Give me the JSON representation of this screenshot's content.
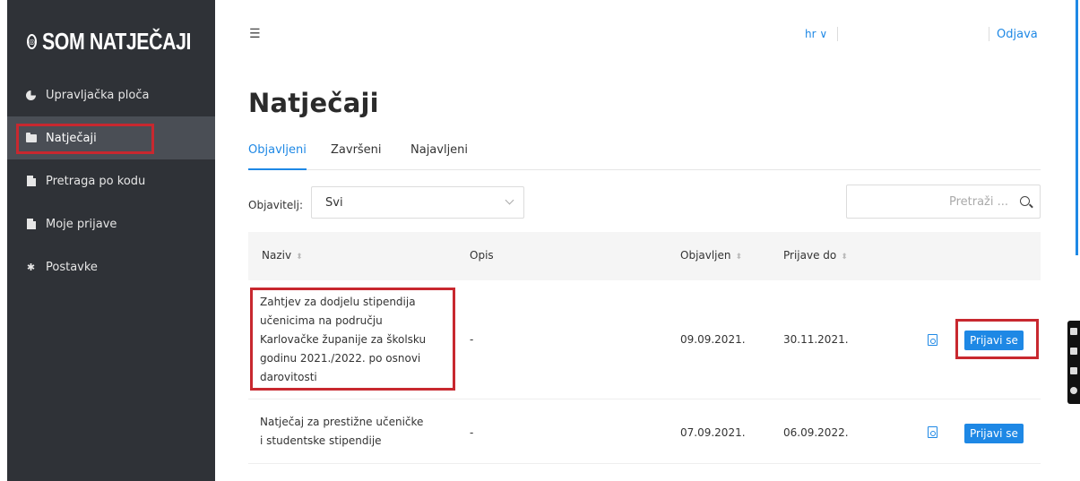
{
  "sidebar": {
    "logo": "SOM NATJEČAJI",
    "items": [
      {
        "label": "Upravljačka ploča",
        "icon": "pie-chart-icon"
      },
      {
        "label": "Natječaji",
        "icon": "folder-icon",
        "active": true
      },
      {
        "label": "Pretraga po kodu",
        "icon": "document-icon"
      },
      {
        "label": "Moje prijave",
        "icon": "document-icon"
      },
      {
        "label": "Postavke",
        "icon": "gear-icon"
      }
    ]
  },
  "topbar": {
    "language": "hr ∨",
    "logout": "Odjava"
  },
  "page": {
    "title": "Natječaji",
    "tabs": [
      {
        "label": "Objavljeni",
        "active": true
      },
      {
        "label": "Završeni"
      },
      {
        "label": "Najavljeni"
      }
    ]
  },
  "filters": {
    "publisher_label": "Objavitelj:",
    "publisher_value": "Svi",
    "search_placeholder": "Pretraži ..."
  },
  "table": {
    "columns": [
      "Naziv",
      "Opis",
      "Objavljen",
      "Prijave do"
    ],
    "rows": [
      {
        "naziv_lines": [
          "Zahtjev za dodjelu stipendija",
          "učenicima na području",
          "Karlovačke županije za školsku",
          "godinu 2021./2022. po osnovi",
          "darovitosti"
        ],
        "opis": "-",
        "objavljen": "09.09.2021.",
        "prijave_do": "30.11.2021.",
        "action": "Prijavi se"
      },
      {
        "naziv_lines": [
          "Natječaj za prestižne učeničke",
          "i studentske stipendije"
        ],
        "opis": "-",
        "objavljen": "07.09.2021.",
        "prijave_do": "06.09.2022.",
        "action": "Prijavi se"
      }
    ]
  },
  "colors": {
    "sidebar_bg": "#2f3237",
    "accent": "#1e88e5",
    "highlight": "#c8282f"
  }
}
